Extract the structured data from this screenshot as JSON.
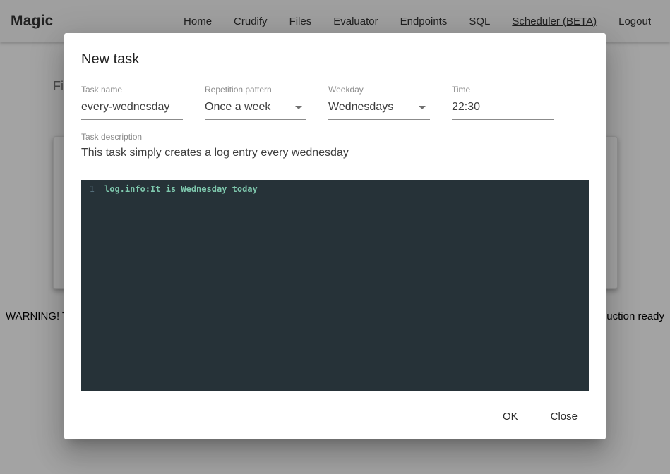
{
  "navbar": {
    "brand": "Magic",
    "items": [
      "Home",
      "Crudify",
      "Files",
      "Evaluator",
      "Endpoints",
      "SQL",
      "Scheduler (BETA)",
      "Logout"
    ],
    "active_item": "Scheduler (BETA)"
  },
  "background": {
    "filter_text_fragment": "Fil",
    "warning_fragment_left": "WARNING! T",
    "warning_fragment_right": "uction ready",
    "warning_color": "#f44336"
  },
  "dialog": {
    "title": "New task",
    "task_name": {
      "label": "Task name",
      "value": "every-wednesday"
    },
    "repetition": {
      "label": "Repetition pattern",
      "value": "Once a week"
    },
    "weekday": {
      "label": "Weekday",
      "value": "Wednesdays"
    },
    "time": {
      "label": "Time",
      "value": "22:30"
    },
    "description": {
      "label": "Task description",
      "value": "This task simply creates a log entry every wednesday"
    },
    "editor": {
      "line_number": "1",
      "code": "log.info:It is Wednesday today",
      "background_color": "#263238",
      "code_color": "#7fc9ae"
    },
    "actions": {
      "ok": "OK",
      "close": "Close"
    }
  }
}
